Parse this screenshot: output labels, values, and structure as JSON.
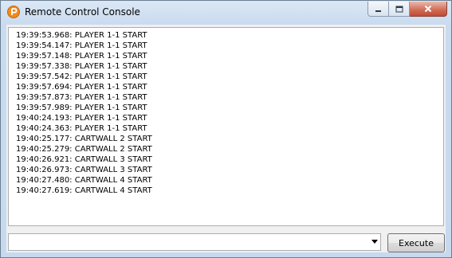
{
  "window": {
    "title": "Remote Control Console",
    "controls": {
      "minimize": "—",
      "maximize": "□",
      "close": "✕"
    }
  },
  "log": {
    "lines": [
      "19:39:53.968: PLAYER 1-1 START",
      "19:39:54.147: PLAYER 1-1 START",
      "19:39:57.148: PLAYER 1-1 START",
      "19:39:57.338: PLAYER 1-1 START",
      "19:39:57.542: PLAYER 1-1 START",
      "19:39:57.694: PLAYER 1-1 START",
      "19:39:57.873: PLAYER 1-1 START",
      "19:39:57.989: PLAYER 1-1 START",
      "19:40:24.193: PLAYER 1-1 START",
      "19:40:24.363: PLAYER 1-1 START",
      "19:40:25.177: CARTWALL 2 START",
      "19:40:25.279: CARTWALL 2 START",
      "19:40:26.921: CARTWALL 3 START",
      "19:40:26.973: CARTWALL 3 START",
      "19:40:27.480: CARTWALL 4 START",
      "19:40:27.619: CARTWALL 4 START"
    ]
  },
  "command": {
    "value": "",
    "execute_label": "Execute"
  },
  "icons": {
    "app": "app-logo-icon",
    "dropdown": "chevron-down-icon"
  },
  "colors": {
    "app_icon": "#f08a1c",
    "close_button": "#c94f3b"
  }
}
